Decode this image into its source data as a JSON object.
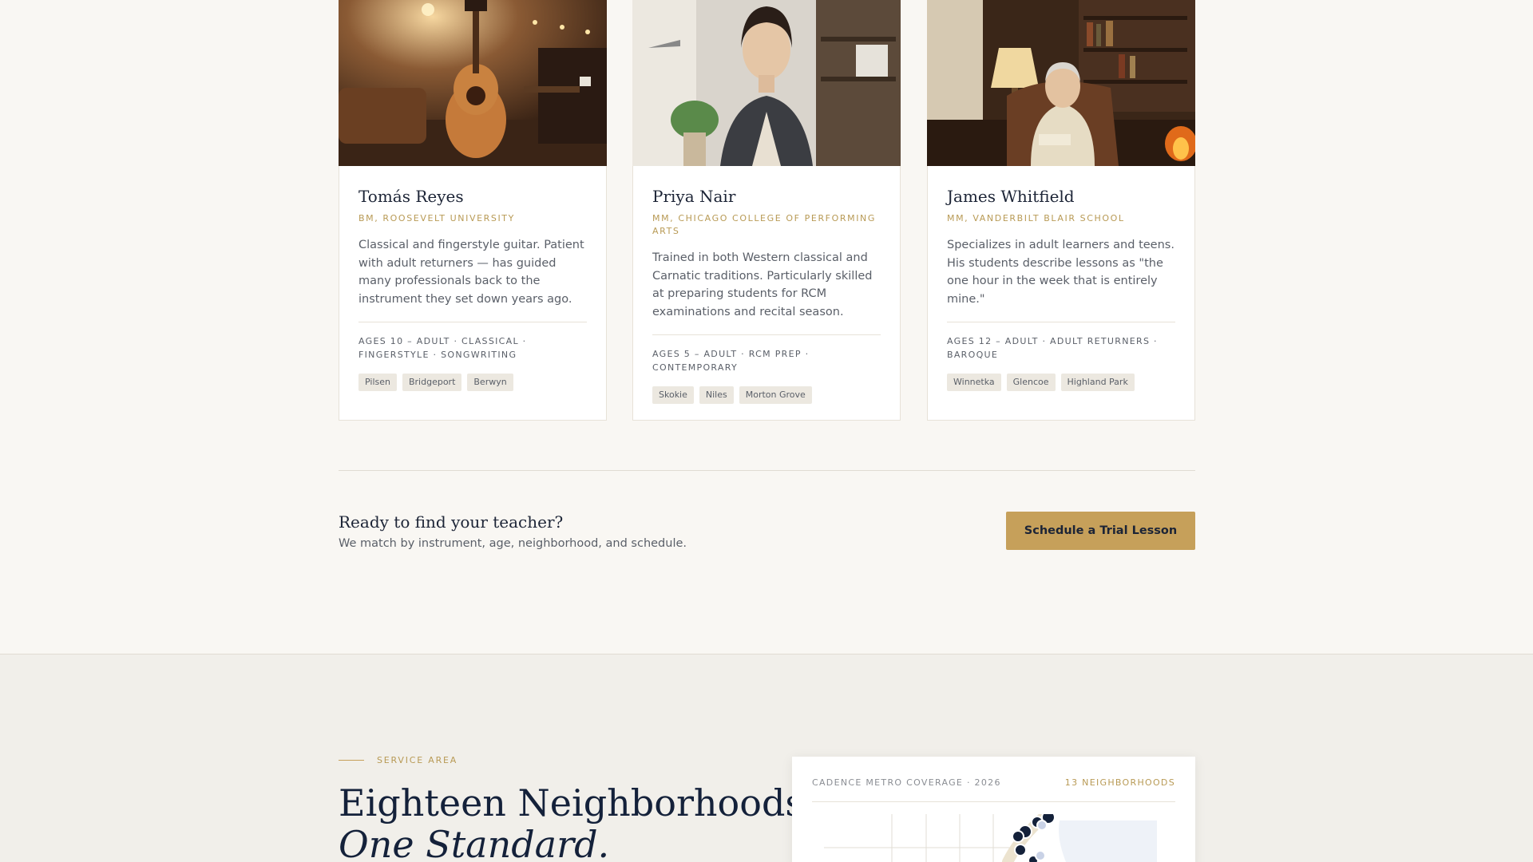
{
  "teachers": [
    {
      "name": "Tomás Reyes",
      "credential": "BM, Roosevelt University",
      "description": "Classical and fingerstyle guitar. Patient with adult returners — has guided many professionals back to the instrument they set down years ago.",
      "meta": "Ages 10 – Adult · Classical · Fingerstyle · Songwriting",
      "neighborhoods": [
        "Pilsen",
        "Bridgeport",
        "Berwyn"
      ]
    },
    {
      "name": "Priya Nair",
      "credential": "MM, Chicago College of Performing Arts",
      "description": "Trained in both Western classical and Carnatic traditions. Particularly skilled at preparing students for RCM examinations and recital season.",
      "meta": "Ages 5 – Adult · RCM Prep · Contemporary",
      "neighborhoods": [
        "Skokie",
        "Niles",
        "Morton Grove"
      ]
    },
    {
      "name": "James Whitfield",
      "credential": "MM, Vanderbilt Blair School",
      "description": "Specializes in adult learners and teens. His students describe lessons as \"the one hour in the week that is entirely mine.\"",
      "meta": "Ages 12 – Adult · Adult Returners · Baroque",
      "neighborhoods": [
        "Winnetka",
        "Glencoe",
        "Highland Park"
      ]
    }
  ],
  "cta": {
    "title": "Ready to find your teacher?",
    "subtitle": "We match by instrument, age, neighborhood, and schedule.",
    "button": "Schedule a Trial Lesson"
  },
  "service_area": {
    "eyebrow": "Service Area",
    "heading_line1": "Eighteen Neighborhoods.",
    "heading_line2": "One Standard.",
    "map_label": "Cadence Metro Coverage · 2026",
    "map_count": "13 Neighborhoods"
  },
  "colors": {
    "accent_gold": "#c6a05a",
    "navy": "#14213a",
    "background": "#f9f7f3"
  }
}
